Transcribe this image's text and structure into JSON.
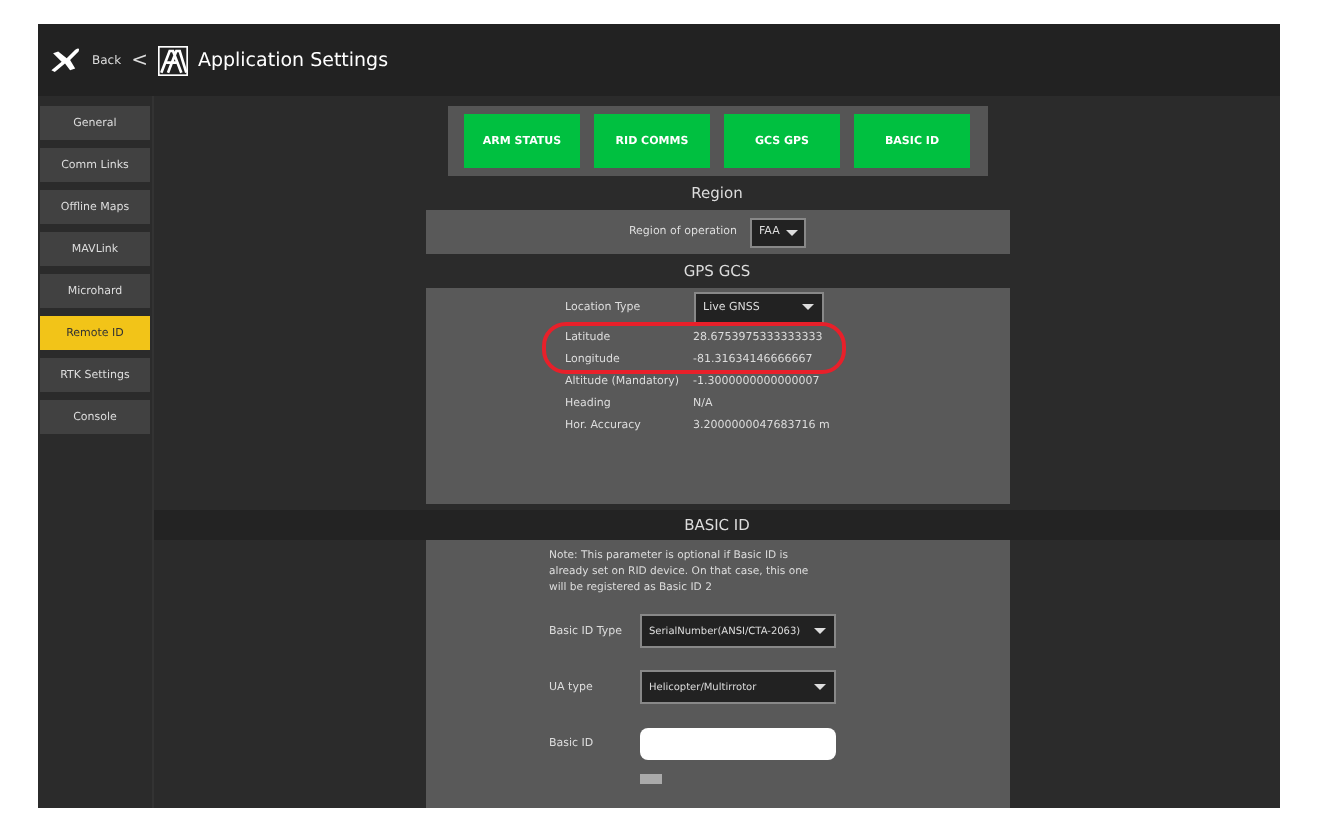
{
  "header": {
    "back": "Back",
    "back_arrow": "<",
    "title": "Application Settings"
  },
  "sidebar": {
    "items": [
      {
        "label": "General",
        "selected": false
      },
      {
        "label": "Comm Links",
        "selected": false
      },
      {
        "label": "Offline Maps",
        "selected": false
      },
      {
        "label": "MAVLink",
        "selected": false
      },
      {
        "label": "Microhard",
        "selected": false
      },
      {
        "label": "Remote ID",
        "selected": true
      },
      {
        "label": "RTK Settings",
        "selected": false
      },
      {
        "label": "Console",
        "selected": false
      }
    ]
  },
  "status_buttons": [
    {
      "label": "ARM STATUS",
      "color": "#00c040"
    },
    {
      "label": "RID COMMS",
      "color": "#00c040"
    },
    {
      "label": "GCS GPS",
      "color": "#00c040"
    },
    {
      "label": "BASIC ID",
      "color": "#00c040"
    }
  ],
  "region": {
    "title": "Region",
    "label": "Region of operation",
    "value": "FAA"
  },
  "gps_gcs": {
    "title": "GPS GCS",
    "location_type_label": "Location Type",
    "location_type": "Live GNSS",
    "highlight_outline": true,
    "rows": [
      {
        "label": "Latitude",
        "value": "28.6753975333333333"
      },
      {
        "label": "Longitude",
        "value": "-81.31634146666667"
      },
      {
        "label": "Altitude (Mandatory)",
        "value": "-1.3000000000000007"
      },
      {
        "label": "Heading",
        "value": "N/A"
      },
      {
        "label": "Hor. Accuracy",
        "value": "3.2000000047683716 m"
      }
    ]
  },
  "basic_id": {
    "title": "BASIC ID",
    "note": "Note: This parameter is optional if Basic ID is already set on RID device. On that case, this one will be registered as Basic ID 2",
    "fields": [
      {
        "kind": "select",
        "label": "Basic ID Type",
        "value": "SerialNumber(ANSI/CTA-2063)"
      },
      {
        "kind": "select",
        "label": "UA type",
        "value": "Helicopter/Multirrotor"
      },
      {
        "kind": "input",
        "label": "Basic ID"
      }
    ],
    "checkbox": {
      "checked": false
    }
  }
}
